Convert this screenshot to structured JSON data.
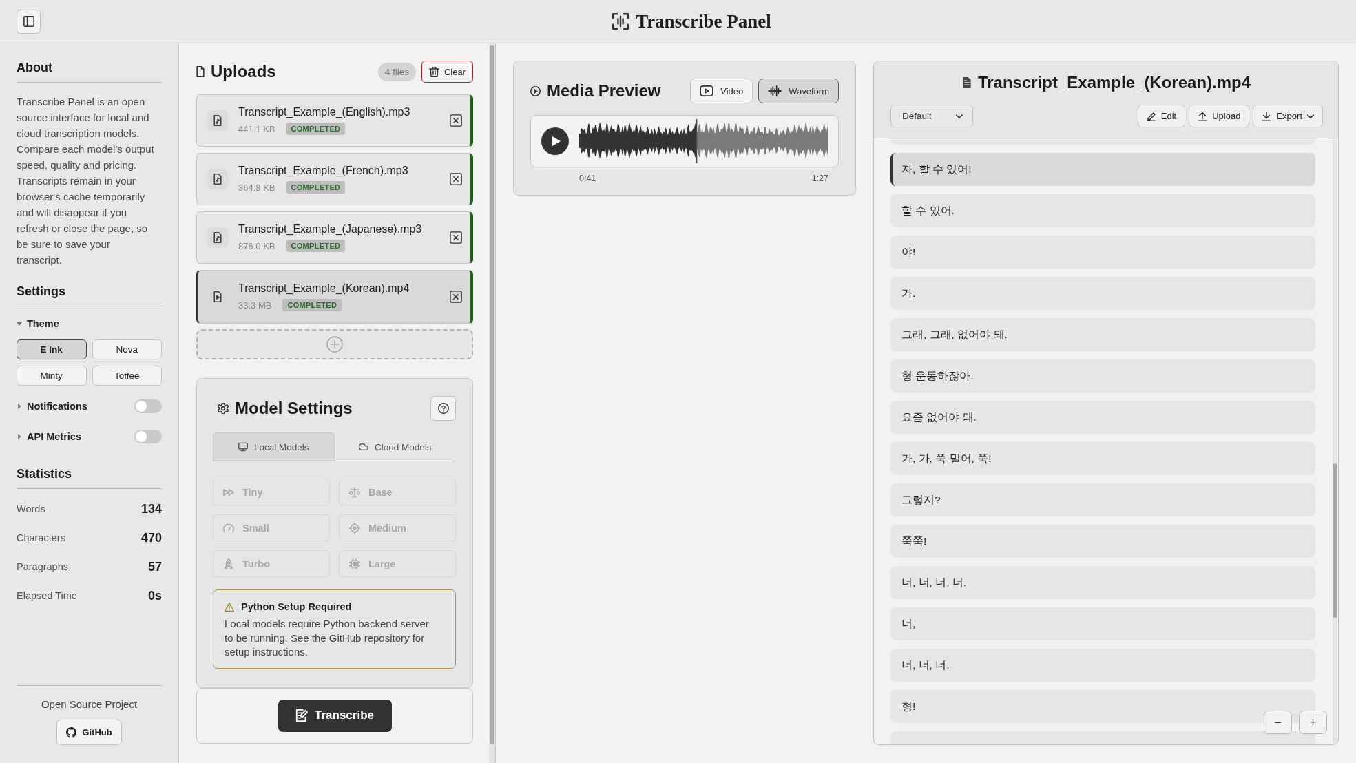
{
  "header": {
    "title": "Transcribe Panel"
  },
  "sidebar": {
    "about": {
      "heading": "About",
      "text": "Transcribe Panel is an open source interface for local and cloud transcription models. Compare each model's output speed, quality and pricing. Transcripts remain in your browser's cache temporarily and will disappear if you refresh or close the page, so be sure to save your transcript."
    },
    "settings": {
      "heading": "Settings",
      "theme": {
        "label": "Theme",
        "expanded": true,
        "options": [
          {
            "label": "E Ink",
            "selected": true
          },
          {
            "label": "Nova",
            "selected": false
          },
          {
            "label": "Minty",
            "selected": false
          },
          {
            "label": "Toffee",
            "selected": false
          }
        ]
      },
      "toggles": [
        {
          "label": "Notifications",
          "expanded": false,
          "on": false
        },
        {
          "label": "API Metrics",
          "expanded": false,
          "on": false
        }
      ]
    },
    "statistics": {
      "heading": "Statistics",
      "items": [
        {
          "label": "Words",
          "value": "134"
        },
        {
          "label": "Characters",
          "value": "470"
        },
        {
          "label": "Paragraphs",
          "value": "57"
        },
        {
          "label": "Elapsed Time",
          "value": "0s"
        }
      ]
    },
    "footer": {
      "text": "Open Source Project",
      "button": "GitHub"
    }
  },
  "uploads": {
    "title": "Uploads",
    "count": "4 files",
    "clear_button": "Clear",
    "files": [
      {
        "name": "Transcript_Example_(English).mp3",
        "size": "441.1 KB",
        "status": "COMPLETED",
        "kind": "audio",
        "selected": false
      },
      {
        "name": "Transcript_Example_(French).mp3",
        "size": "364.8 KB",
        "status": "COMPLETED",
        "kind": "audio",
        "selected": false
      },
      {
        "name": "Transcript_Example_(Japanese).mp3",
        "size": "876.0 KB",
        "status": "COMPLETED",
        "kind": "audio",
        "selected": false
      },
      {
        "name": "Transcript_Example_(Korean).mp4",
        "size": "33.3 MB",
        "status": "COMPLETED",
        "kind": "video",
        "selected": true
      }
    ]
  },
  "model_settings": {
    "title": "Model Settings",
    "tabs": [
      {
        "label": "Local Models",
        "selected": true
      },
      {
        "label": "Cloud Models",
        "selected": false
      }
    ],
    "models": [
      {
        "label": "Tiny",
        "disabled": true
      },
      {
        "label": "Base",
        "disabled": true
      },
      {
        "label": "Small",
        "disabled": true
      },
      {
        "label": "Medium",
        "disabled": true
      },
      {
        "label": "Turbo",
        "disabled": true
      },
      {
        "label": "Large",
        "disabled": true
      }
    ],
    "notice": {
      "title": "Python Setup Required",
      "text": "Local models require Python backend server to be running. See the GitHub repository for setup instructions."
    }
  },
  "transcribe_button": "Transcribe",
  "media_preview": {
    "title": "Media Preview",
    "modes": [
      {
        "label": "Video",
        "selected": false
      },
      {
        "label": "Waveform",
        "selected": true
      }
    ],
    "player": {
      "level": 0.47,
      "current_time": "0:41",
      "duration": "1:27"
    }
  },
  "transcript": {
    "title": "Transcript_Example_(Korean).mp4",
    "format": "Default",
    "actions": [
      {
        "label": "Edit",
        "menu": false
      },
      {
        "label": "Upload",
        "menu": false
      },
      {
        "label": "Export",
        "menu": true
      }
    ],
    "more_above": true,
    "segments": [
      {
        "text": "자, 할 수 있어!",
        "selected": true
      },
      {
        "text": "할 수 있어.",
        "selected": false
      },
      {
        "text": "야!",
        "selected": false
      },
      {
        "text": "가.",
        "selected": false
      },
      {
        "text": "그래, 그래, 없어야 돼.",
        "selected": false
      },
      {
        "text": "형 운동하잖아.",
        "selected": false
      },
      {
        "text": "요즘 없어야 돼.",
        "selected": false
      },
      {
        "text": "가, 가, 쭉 밀어, 쭉!",
        "selected": false
      },
      {
        "text": "그렇지?",
        "selected": false
      },
      {
        "text": "쭉쭉!",
        "selected": false
      },
      {
        "text": "너, 너, 너, 너.",
        "selected": false
      },
      {
        "text": "너,",
        "selected": false
      },
      {
        "text": "너, 너, 너.",
        "selected": false
      },
      {
        "text": "형!",
        "selected": false
      }
    ],
    "more_below": true,
    "zoom_controls": [
      "−",
      "+"
    ]
  }
}
